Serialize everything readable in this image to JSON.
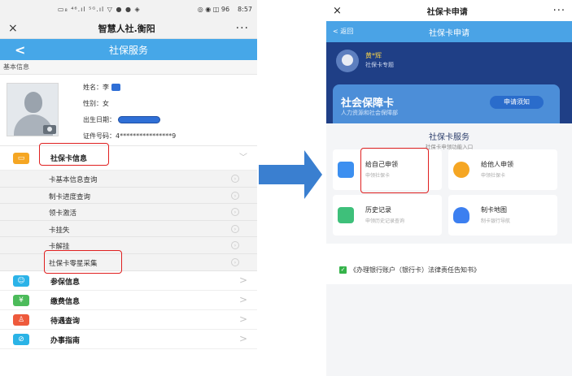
{
  "left": {
    "status_bar": {
      "signal": "▭₈ ⁴⁶.ıl ⁵ᴳ.ıl ▽ ● ● ◈",
      "icons": "◎ ◉ ◫ 96",
      "time": "8:57"
    },
    "window_title": "智慧人社.衡阳",
    "close_icon": "×",
    "more_icon": "···",
    "header": {
      "back_icon": "<",
      "title": "社保服务"
    },
    "basic_info_label": "基本信息",
    "profile": {
      "name_label": "姓名：李",
      "gender_label": "性别：女",
      "birth_label": "出生日期：",
      "id_label": "证件号码：4****************9"
    },
    "card_section": {
      "title": "社保卡信息",
      "items": [
        {
          "label": "卡基本信息查询"
        },
        {
          "label": "制卡进度查询"
        },
        {
          "label": "领卡激活"
        },
        {
          "label": "卡挂失"
        },
        {
          "label": "卡解挂"
        },
        {
          "label": "社保卡零星采集"
        }
      ]
    },
    "menu": [
      {
        "label": "参保信息",
        "icon": "person-icon",
        "color": "#2bb3e8"
      },
      {
        "label": "缴费信息",
        "icon": "coin-icon",
        "color": "#4cbb5a"
      },
      {
        "label": "待遇查询",
        "icon": "benefit-icon",
        "color": "#ee5a3c"
      },
      {
        "label": "办事指南",
        "icon": "compass-icon",
        "color": "#2ab3e6"
      }
    ],
    "colors": {
      "header": "#46a7e8",
      "highlight": "#e02020"
    }
  },
  "right": {
    "window_title": "社保卡申请",
    "close_icon": "×",
    "more_icon": "···",
    "header": {
      "back_label": "< 返回",
      "title": "社保卡申请"
    },
    "user": {
      "name": "黄*辉",
      "subtitle": "社保卡专题"
    },
    "card": {
      "title": "社会保障卡",
      "subtitle": "人力资源和社会保障部",
      "notice_button": "申请须知"
    },
    "services": {
      "title": "社保卡服务",
      "subtitle": "社保卡申领功能入口",
      "tiles": [
        {
          "title": "给自己申领",
          "subtitle": "申领社保卡",
          "icon": "calendar-icon",
          "color": "#3c8ff0"
        },
        {
          "title": "给他人申领",
          "subtitle": "申领社保卡",
          "icon": "add-person-icon",
          "color": "#f5a623"
        },
        {
          "title": "历史记录",
          "subtitle": "申领历史记录查询",
          "icon": "history-icon",
          "color": "#3ec07a"
        },
        {
          "title": "制卡地图",
          "subtitle": "制卡银行导航",
          "icon": "map-icon",
          "color": "#3c7ff0"
        }
      ]
    },
    "agreement": "《办理银行账户（银行卡）法律责任告知书》",
    "colors": {
      "header": "#4aa3e6",
      "banner": "#1f3f86"
    }
  },
  "arrow_color": "#3a7fd0"
}
